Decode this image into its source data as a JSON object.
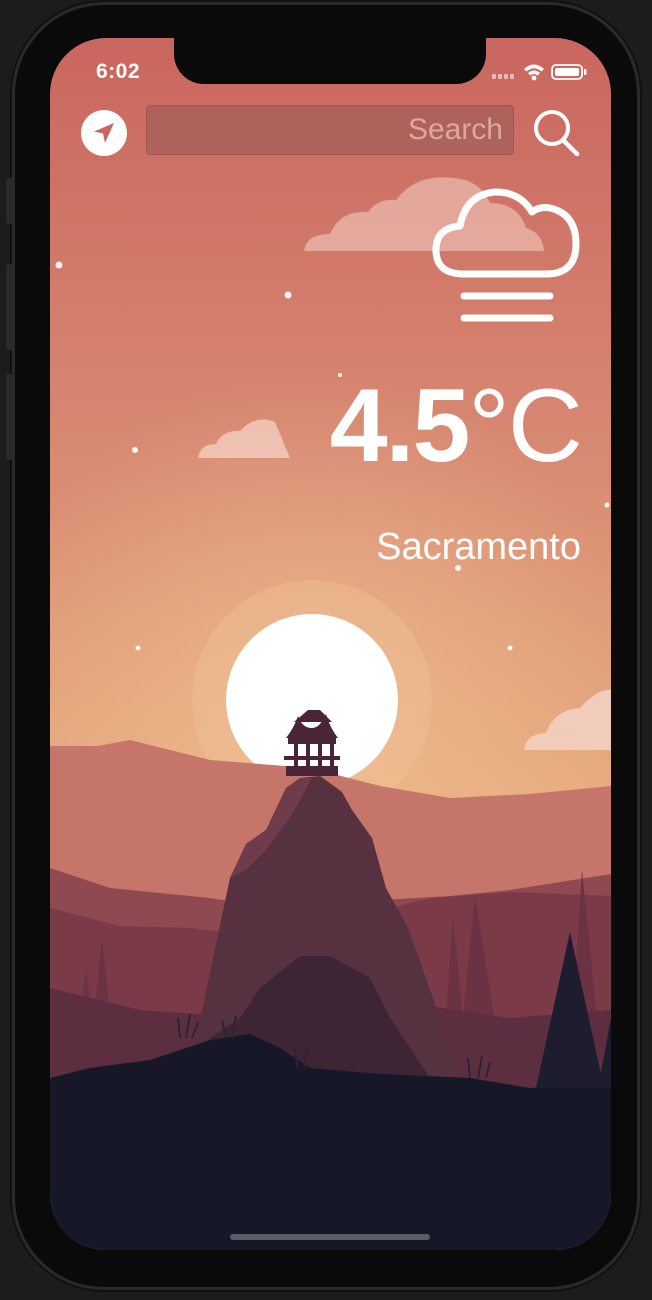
{
  "status_bar": {
    "time": "6:02"
  },
  "search": {
    "placeholder": "Search",
    "value": ""
  },
  "weather": {
    "temperature": "4.5",
    "unit": "°C",
    "city": "Sacramento",
    "condition_icon": "fog-cloud-icon"
  },
  "icons": {
    "location": "location-arrow-icon",
    "search": "magnifier-icon"
  },
  "colors": {
    "sky_top": "#cc6e64",
    "sky_bottom": "#e8b47c",
    "foreground": "#161827"
  }
}
